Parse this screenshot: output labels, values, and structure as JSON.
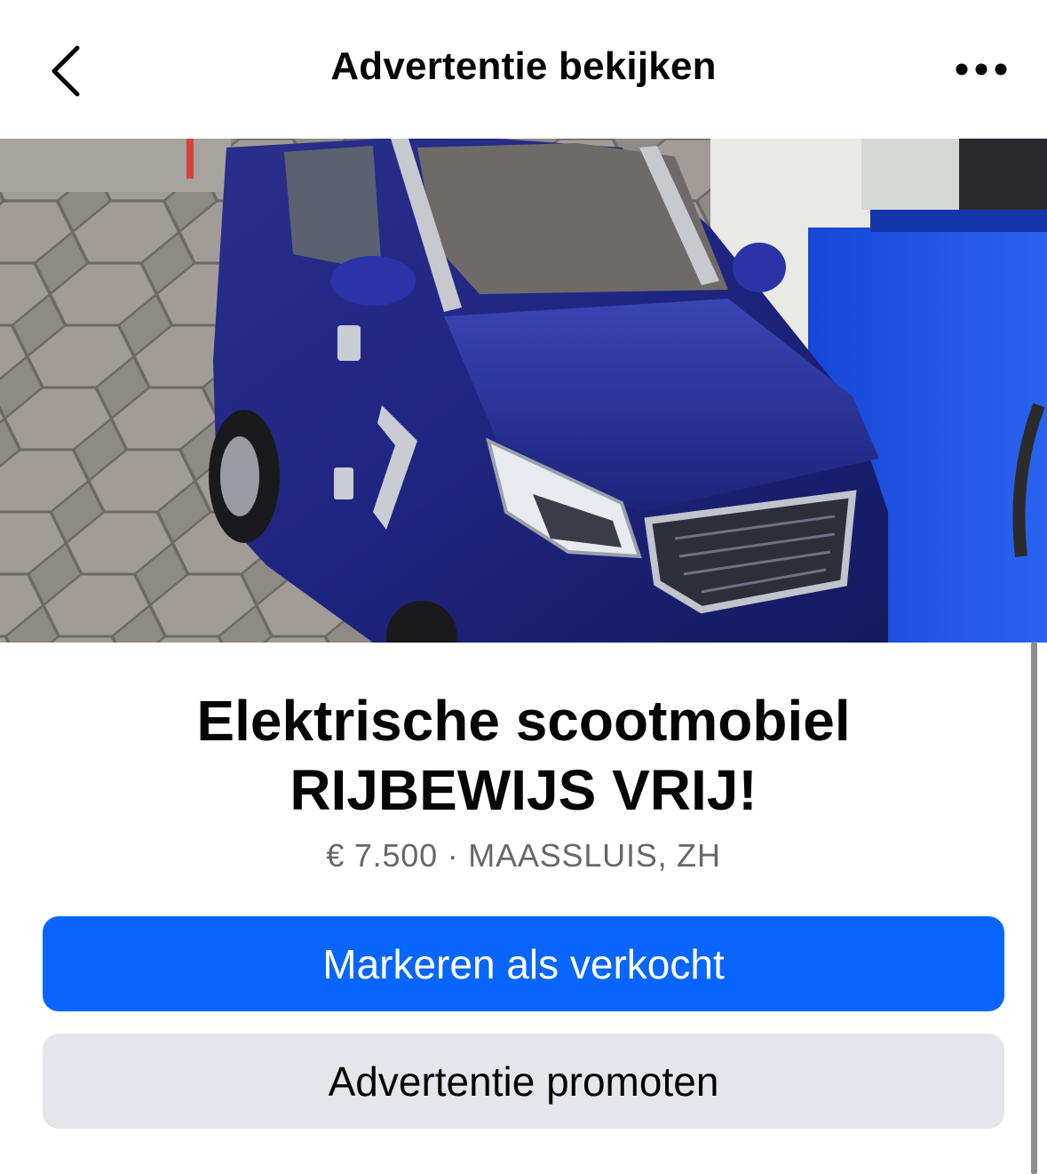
{
  "header": {
    "title": "Advertentie bekijken",
    "back_icon": "chevron-left-icon",
    "more_icon": "more-horizontal-icon"
  },
  "photo": {
    "description_icon": "listing-photo",
    "carousel": {
      "count": 7,
      "active_index": 0
    }
  },
  "listing": {
    "title": "Elektrische scootmobiel RIJBEWIJS VRIJ!",
    "meta": "€ 7.500 · MAASSLUIS, ZH"
  },
  "actions": {
    "primary_label": "Markeren als verkocht",
    "secondary_label": "Advertentie promoten"
  },
  "colors": {
    "primary": "#0866ff",
    "secondary_bg": "#e4e6eb",
    "text": "#050505",
    "muted": "#65676b"
  }
}
